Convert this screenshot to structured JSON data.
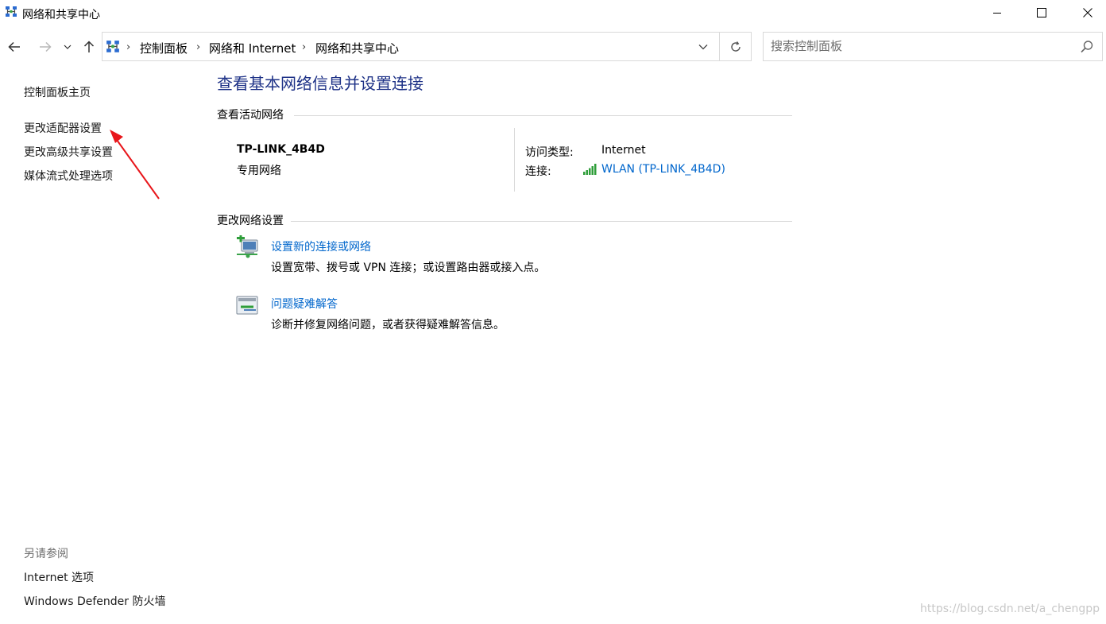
{
  "window": {
    "title": "网络和共享中心",
    "controls": [
      "minimize-icon",
      "maximize-icon",
      "close-icon"
    ]
  },
  "navigation": {
    "breadcrumbs": [
      "控制面板",
      "网络和 Internet",
      "网络和共享中心"
    ],
    "icons": [
      "back-arrow-icon",
      "forward-arrow-icon",
      "chevron-down-icon",
      "up-arrow-icon",
      "refresh-icon"
    ]
  },
  "search": {
    "placeholder": "搜索控制面板",
    "value": ""
  },
  "sidebar": {
    "links": [
      "控制面板主页",
      "更改适配器设置",
      "更改高级共享设置",
      "媒体流式处理选项"
    ],
    "see_also_heading": "另请参阅",
    "see_also_links": [
      "Internet 选项",
      "Windows Defender 防火墙"
    ]
  },
  "main": {
    "title": "查看基本网络信息并设置连接",
    "active_networks_heading": "查看活动网络",
    "network": {
      "name": "TP-LINK_4B4D",
      "category": "专用网络",
      "access_type_label": "访问类型:",
      "access_type_value": "Internet",
      "connection_label": "连接:",
      "connection_value": "WLAN (TP-LINK_4B4D)"
    },
    "change_settings_heading": "更改网络设置",
    "tasks": [
      {
        "title": "设置新的连接或网络",
        "description": "设置宽带、拨号或 VPN 连接；或设置路由器或接入点。"
      },
      {
        "title": "问题疑难解答",
        "description": "诊断并修复网络问题，或者获得疑难解答信息。"
      }
    ]
  },
  "colors": {
    "heading_blue": "#1e3287",
    "link_blue": "#0066cc",
    "annotation_red": "#e8161b",
    "border": "#d9d9d9"
  },
  "watermark": "https://blog.csdn.net/a_chengpp"
}
